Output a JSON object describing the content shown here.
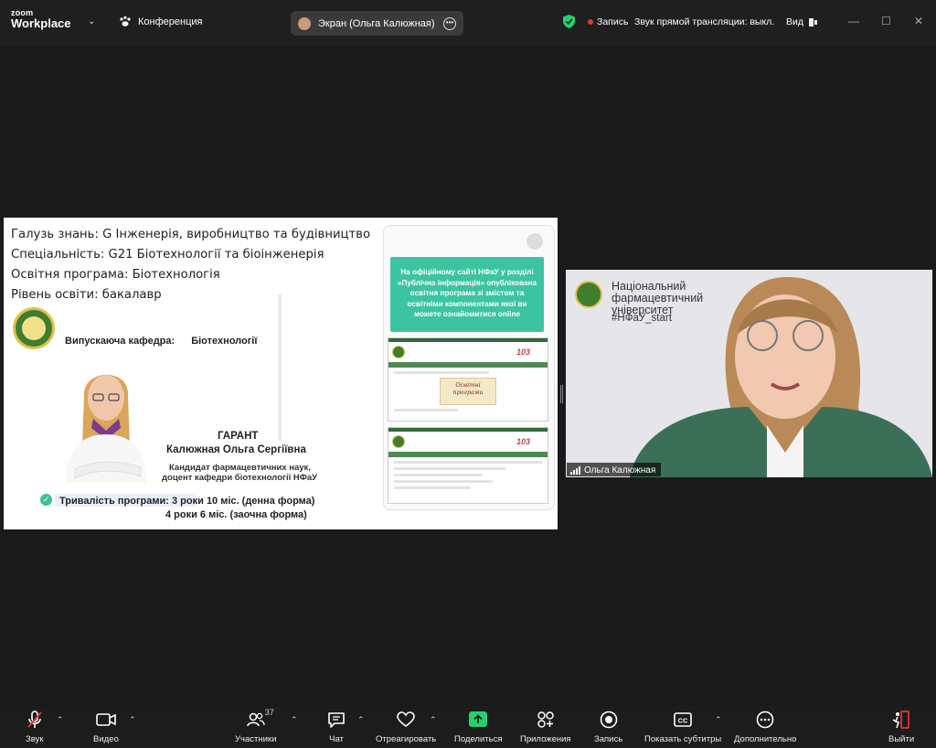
{
  "app": {
    "logo_line1": "zoom",
    "logo_line2": "Workplace",
    "conference_label": "Конференция",
    "screen_share_label": "Экран (Ольга Калюжная)",
    "recording_label": "Запись",
    "stream_audio_label": "Звук прямой трансляции: выкл.",
    "view_label": "Вид",
    "colors": {
      "accent_green": "#26d06e",
      "record_red": "#e0362f",
      "teal": "#3cc4a2",
      "nfau_green": "#3f7d2f"
    }
  },
  "slide": {
    "lines": [
      "Галузь знань: G Інженерія, виробництво та будівництво",
      "Спеціальність: G21 Біотехнології та біоінженерія",
      "Освітня програма: Біотехнологія",
      "Рівень освіти: бакалавр"
    ],
    "dept_label": "Випускаюча кафедра:",
    "dept_value": "Біотехнології",
    "guarantee_title": "ГАРАНТ",
    "guarantee_name": "Калюжная Ольга Сергіївна",
    "guarantee_pos1": "Кандидат фармацевтичних наук,",
    "guarantee_pos2": "доцент кафедри біотехнології НФаУ",
    "duration1": "Тривалість програми: 3 роки 10 міс. (денна форма)",
    "duration2": "4 роки 6 міс. (заочна форма)",
    "teal_text": "На офіційному сайті НФаУ у розділі «Публічна інформація» опублікована освітня програма зі змістом та освітніми компонентами якої ви можете ознайомитися online",
    "site_103": "103",
    "edu_card": "Освітні програми"
  },
  "camera": {
    "university": "Національний фармацевтичний університет",
    "hashtag": "#НФаУ_start",
    "participant_name": "Ольга Калюжная"
  },
  "toolbar": {
    "audio": "Звук",
    "video": "Видео",
    "participants": "Участники",
    "participants_count": "37",
    "chat": "Чат",
    "react": "Отреагировать",
    "share": "Поделиться",
    "apps": "Приложения",
    "record": "Запись",
    "captions": "Показать субтитры",
    "more": "Дополнительно",
    "leave": "Выйти"
  }
}
